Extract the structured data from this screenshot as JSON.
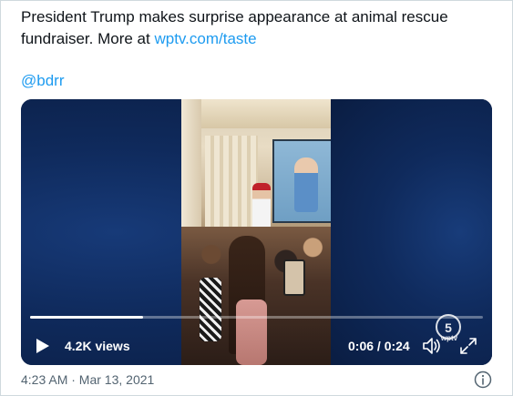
{
  "tweet": {
    "text_part1": "President Trump makes surprise appearance at animal rescue fundraiser.  More at ",
    "link_text": "wptv.com/taste",
    "mention": "@bdrr",
    "timestamp": "4:23 AM · Mar 13, 2021"
  },
  "video": {
    "views": "4.2K views",
    "time": "0:06 / 0:24",
    "watermark": "wptv",
    "watermark_badge": "5",
    "progress_fraction": 0.25
  },
  "icons": {
    "play": "play-icon",
    "volume": "volume-icon",
    "fullscreen": "fullscreen-icon",
    "info": "info-icon"
  },
  "colors": {
    "text": "#0f1419",
    "link": "#1d9bf0",
    "muted": "#536471",
    "video_bg": "#0d2249"
  }
}
